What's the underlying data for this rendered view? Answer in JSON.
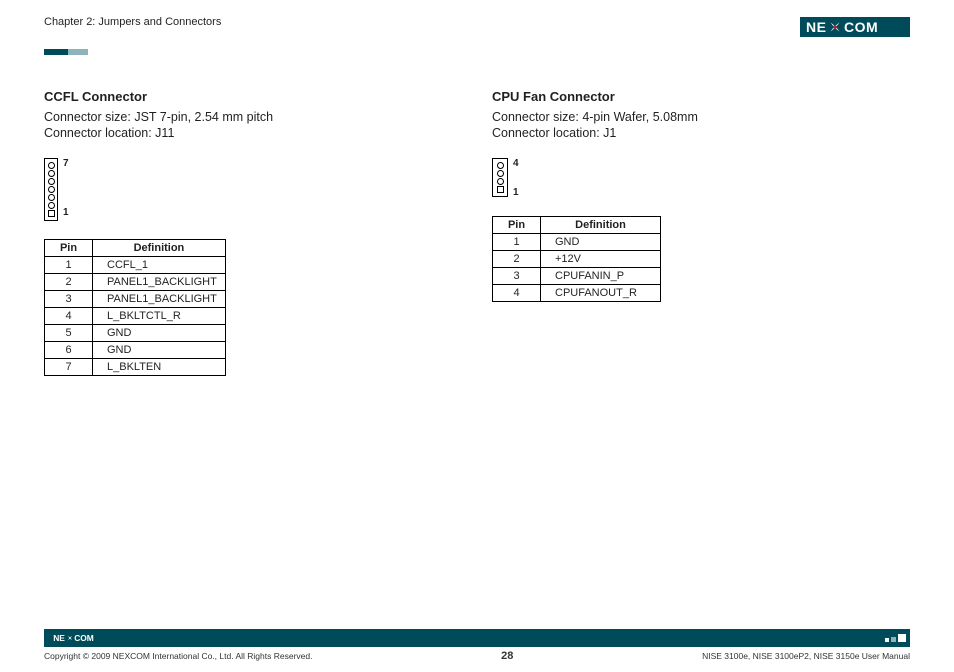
{
  "header": {
    "chapter": "Chapter 2: Jumpers and Connectors",
    "brand": "NEXCOM"
  },
  "left": {
    "title": "CCFL Connector",
    "size_line": "Connector size: JST 7-pin, 2.54 mm pitch",
    "loc_line": "Connector location: J11",
    "pin_top_label": "7",
    "pin_bottom_label": "1",
    "table": {
      "headers": {
        "pin": "Pin",
        "def": "Definition"
      },
      "rows": [
        {
          "pin": "1",
          "def": "CCFL_1"
        },
        {
          "pin": "2",
          "def": "PANEL1_BACKLIGHT"
        },
        {
          "pin": "3",
          "def": "PANEL1_BACKLIGHT"
        },
        {
          "pin": "4",
          "def": "L_BKLTCTL_R"
        },
        {
          "pin": "5",
          "def": "GND"
        },
        {
          "pin": "6",
          "def": "GND"
        },
        {
          "pin": "7",
          "def": "L_BKLTEN"
        }
      ]
    }
  },
  "right": {
    "title": "CPU Fan Connector",
    "size_line": "Connector size: 4-pin Wafer, 5.08mm",
    "loc_line": "Connector location: J1",
    "pin_top_label": "4",
    "pin_bottom_label": "1",
    "table": {
      "headers": {
        "pin": "Pin",
        "def": "Definition"
      },
      "rows": [
        {
          "pin": "1",
          "def": "GND"
        },
        {
          "pin": "2",
          "def": "+12V"
        },
        {
          "pin": "3",
          "def": "CPUFANIN_P"
        },
        {
          "pin": "4",
          "def": "CPUFANOUT_R"
        }
      ]
    }
  },
  "footer": {
    "copyright": "Copyright © 2009 NEXCOM International Co., Ltd. All Rights Reserved.",
    "page": "28",
    "manual": "NISE 3100e, NISE 3100eP2, NISE 3150e User Manual"
  }
}
